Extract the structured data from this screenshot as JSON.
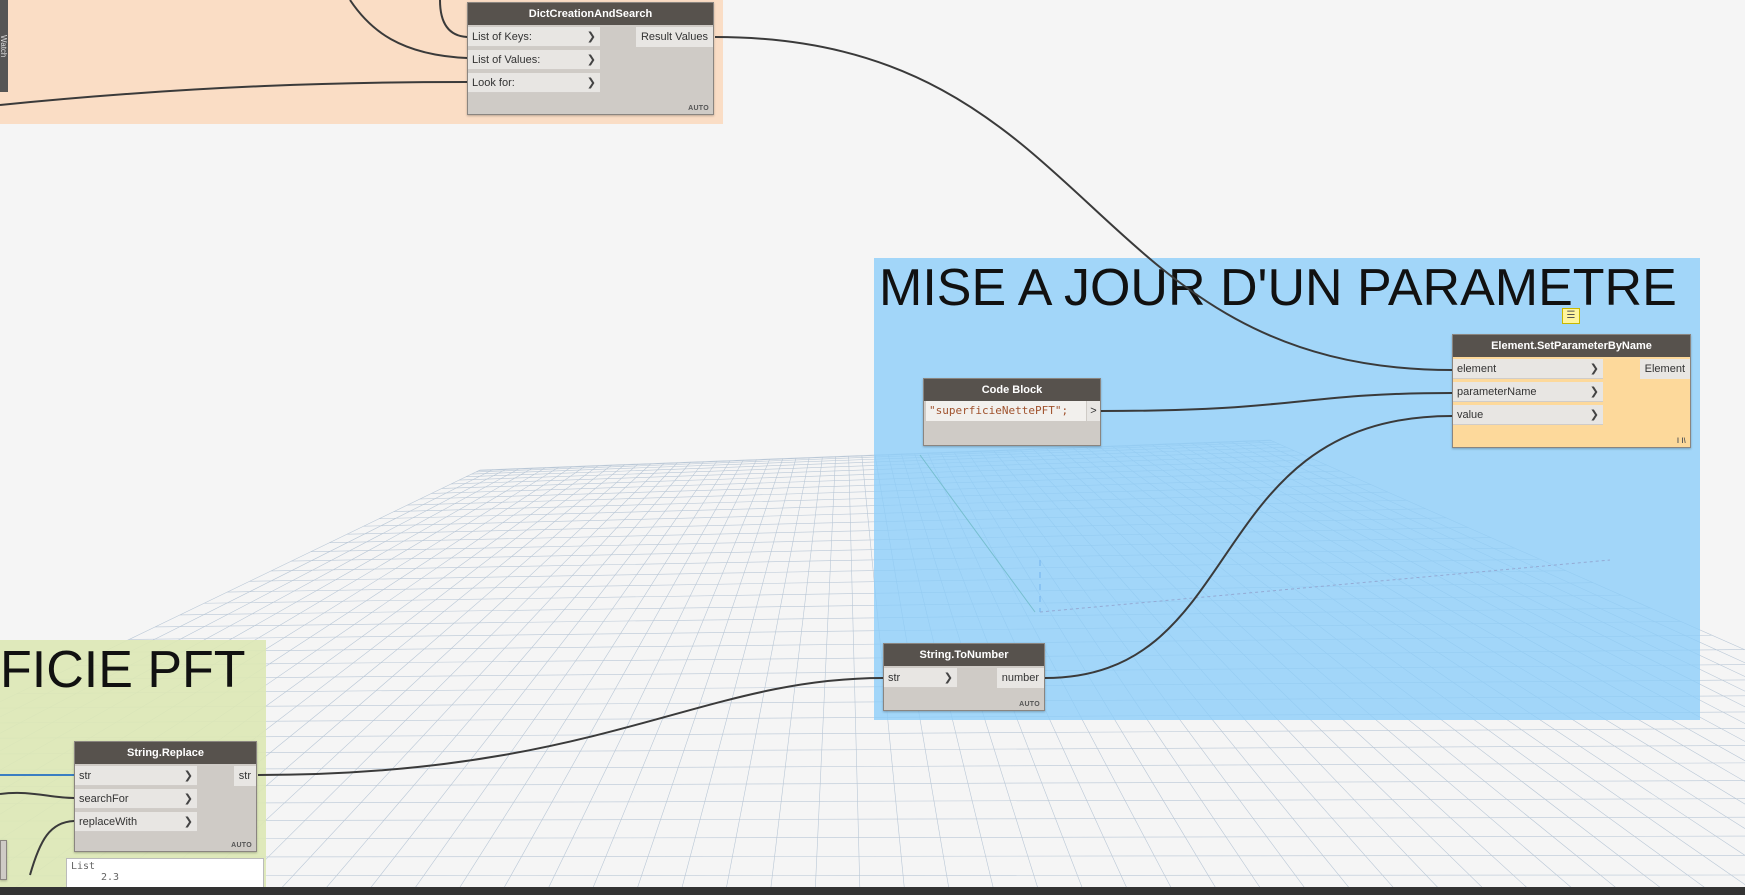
{
  "groups": {
    "dict_group": {
      "title": "",
      "color": "#fbdcc0"
    },
    "mise_a_jour": {
      "title": "MISE  A JOUR D'UN PARAMETRE",
      "color": "#a4d7f8"
    },
    "superficie": {
      "title": "FICIE PFT",
      "color": "#dfe8b8"
    }
  },
  "nodes": {
    "dict": {
      "title": "DictCreationAndSearch",
      "inputs": [
        "List of Keys:",
        "List of Values:",
        "Look for:"
      ],
      "output": "Result Values",
      "lacing": "AUTO"
    },
    "setparam": {
      "title": "Element.SetParameterByName",
      "inputs": [
        "element",
        "parameterName",
        "value"
      ],
      "output": "Element",
      "lacing": "l l\\"
    },
    "codeblock": {
      "title": "Code Block",
      "code": "\"superficieNettePFT\";",
      "output": ">"
    },
    "tonumber": {
      "title": "String.ToNumber",
      "inputs": [
        "str"
      ],
      "output": "number",
      "lacing": "AUTO"
    },
    "replace": {
      "title": "String.Replace",
      "inputs": [
        "str",
        "searchFor",
        "replaceWith"
      ],
      "output": "str",
      "lacing": "AUTO"
    }
  },
  "preview": {
    "line1": "List",
    "line2": "2.3"
  },
  "side_tab": {
    "label": "Watch"
  },
  "icons": {
    "note": "note-icon",
    "chevron": "chevron-right-icon"
  }
}
